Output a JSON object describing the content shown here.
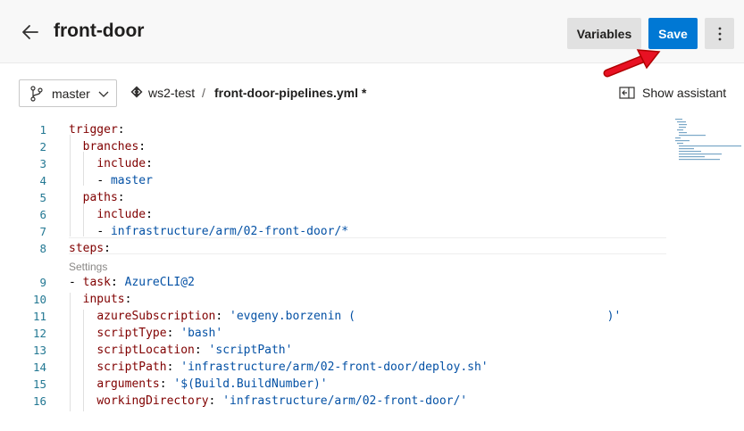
{
  "header": {
    "title": "front-door",
    "variables_label": "Variables",
    "save_label": "Save"
  },
  "toolbar": {
    "branch": "master",
    "repo": "ws2-test",
    "separator": "/",
    "file": "front-door-pipelines.yml *",
    "show_assistant": "Show assistant"
  },
  "editor": {
    "codelens": "Settings",
    "lines": [
      {
        "num": "1",
        "text": "trigger:"
      },
      {
        "num": "2",
        "text": "  branches:"
      },
      {
        "num": "3",
        "text": "    include:"
      },
      {
        "num": "4",
        "text": "    - master"
      },
      {
        "num": "5",
        "text": "  paths:"
      },
      {
        "num": "6",
        "text": "    include:"
      },
      {
        "num": "7",
        "text": "    - infrastructure/arm/02-front-door/*"
      },
      {
        "num": "8",
        "text": "steps:"
      },
      {
        "num": "9",
        "text": "- task: AzureCLI@2"
      },
      {
        "num": "10",
        "text": "  inputs:"
      },
      {
        "num": "11",
        "text": "    azureSubscription: 'evgeny.borzenin (                                    )'"
      },
      {
        "num": "12",
        "text": "    scriptType: 'bash'"
      },
      {
        "num": "13",
        "text": "    scriptLocation: 'scriptPath'"
      },
      {
        "num": "14",
        "text": "    scriptPath: 'infrastructure/arm/02-front-door/deploy.sh'"
      },
      {
        "num": "15",
        "text": "    arguments: '$(Build.BuildNumber)'"
      },
      {
        "num": "16",
        "text": "    workingDirectory: 'infrastructure/arm/02-front-door/'"
      }
    ]
  },
  "colors": {
    "accent": "#0078d4",
    "annotation_arrow": "#e81123"
  }
}
